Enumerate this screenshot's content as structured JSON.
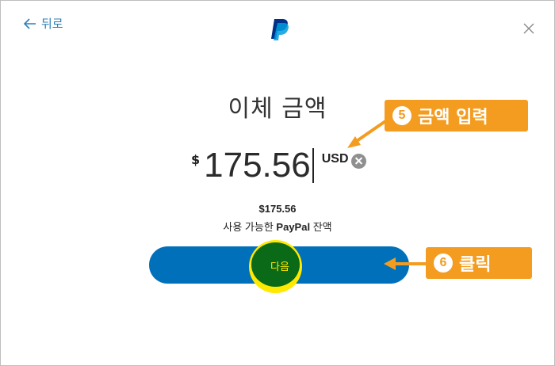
{
  "nav": {
    "back_label": "뒤로",
    "close_icon": "close-icon"
  },
  "heading": "이체 금액",
  "amount": {
    "symbol": "$",
    "value": "175.56",
    "currency": "USD"
  },
  "balance": {
    "amount": "$175.56",
    "prefix": "사용 가능한",
    "brand": "PayPal",
    "suffix": "잔액"
  },
  "next_button": {
    "label": "다음"
  },
  "callouts": [
    {
      "number": "5",
      "text": "금액 입력"
    },
    {
      "number": "6",
      "text": "클릭"
    }
  ],
  "colors": {
    "brand": "#0070ba",
    "callout": "#f39c1f",
    "highlight": "#ffe900",
    "link": "#2e7fb6"
  }
}
